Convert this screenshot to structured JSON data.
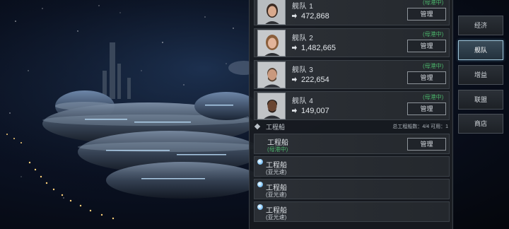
{
  "fleet_panel": {
    "fleets": [
      {
        "name": "舰队 1",
        "power": "472,868",
        "status": "(母港中)",
        "manage_label": "管理",
        "portrait": "woman-dark-hair"
      },
      {
        "name": "舰队 2",
        "power": "1,482,665",
        "status": "(母港中)",
        "manage_label": "管理",
        "portrait": "woman-blonde"
      },
      {
        "name": "舰队 3",
        "power": "222,654",
        "status": "(母港中)",
        "manage_label": "管理",
        "portrait": "man-beard"
      },
      {
        "name": "舰队 4",
        "power": "149,007",
        "status": "(母港中)",
        "manage_label": "管理",
        "portrait": "man-dark-skin"
      }
    ],
    "engineering": {
      "title": "工程船",
      "stats": "总工程船数：4/4 可用：1",
      "ships": [
        {
          "name": "工程船",
          "status": "(母港中)",
          "manage_label": "管理"
        },
        {
          "name": "工程船",
          "status": "(亚光速)"
        },
        {
          "name": "工程船",
          "status": "(亚光速)"
        },
        {
          "name": "工程船",
          "status": "(亚光速)"
        }
      ]
    }
  },
  "side_tabs": [
    {
      "label": "经济",
      "active": false
    },
    {
      "label": "舰队",
      "active": true
    },
    {
      "label": "增益",
      "active": false
    },
    {
      "label": "联盟",
      "active": false
    },
    {
      "label": "商店",
      "active": false
    }
  ],
  "colors": {
    "status_green": "#4bb36a",
    "tab_active_border": "#9ec3d6",
    "panel_bg": "#181b20"
  }
}
